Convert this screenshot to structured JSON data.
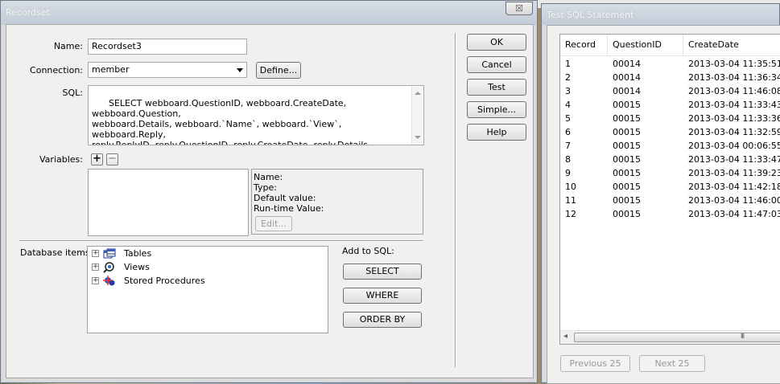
{
  "recordset_dialog": {
    "title": "Recordset",
    "close_label": "☒",
    "name_label": "Name:",
    "name_value": "Recordset3",
    "connection_label": "Connection:",
    "connection_value": "member",
    "define_button": "Define...",
    "sql_label": "SQL:",
    "sql_text": "SELECT webboard.QuestionID, webboard.CreateDate, webboard.Question,\nwebboard.Details, webboard.`Name`, webboard.`View`, webboard.Reply,\nreply.ReplyID, reply.QuestionID, reply.CreateDate, reply.Details, reply.`Name`\nFROM reply Inner Join webboard ON reply.QuestionID = webboard.QuestionID\nORDER BY webboard.QuestionID",
    "variables_label": "Variables:",
    "add_variable": "+",
    "remove_variable": "−",
    "var_detail": {
      "name_label": "Name:",
      "type_label": "Type:",
      "default_label": "Default value:",
      "runtime_label": "Run-time Value:",
      "edit_button": "Edit..."
    },
    "db_items_label": "Database items:",
    "db_items": [
      {
        "label": "Tables",
        "icon": "tables-icon"
      },
      {
        "label": "Views",
        "icon": "views-icon"
      },
      {
        "label": "Stored Procedures",
        "icon": "stored-procedures-icon"
      }
    ],
    "expander_glyph": "+",
    "add_to_sql_label": "Add to SQL:",
    "select_button": "SELECT",
    "where_button": "WHERE",
    "orderby_button": "ORDER BY",
    "ok_button": "OK",
    "cancel_button": "Cancel",
    "test_button": "Test",
    "simple_button": "Simple...",
    "help_button": "Help"
  },
  "test_dialog": {
    "title": "Test SQL Statement",
    "columns": [
      "Record",
      "QuestionID",
      "CreateDate"
    ],
    "rows": [
      [
        "1",
        "00014",
        "2013-03-04 11:35:51"
      ],
      [
        "2",
        "00014",
        "2013-03-04 11:36:34"
      ],
      [
        "3",
        "00014",
        "2013-03-04 11:46:08"
      ],
      [
        "4",
        "00015",
        "2013-03-04 11:33:43"
      ],
      [
        "5",
        "00015",
        "2013-03-04 11:33:36"
      ],
      [
        "6",
        "00015",
        "2013-03-04 11:32:59"
      ],
      [
        "7",
        "00015",
        "2013-03-04 00:06:55"
      ],
      [
        "8",
        "00015",
        "2013-03-04 11:33:47"
      ],
      [
        "9",
        "00015",
        "2013-03-04 11:39:23"
      ],
      [
        "10",
        "00015",
        "2013-03-04 11:42:18"
      ],
      [
        "11",
        "00015",
        "2013-03-04 11:46:00"
      ],
      [
        "12",
        "00015",
        "2013-03-04 11:47:03"
      ]
    ],
    "hscroll_left": "◂",
    "hscroll_grip": "III",
    "previous_button": "Previous 25",
    "next_button": "Next 25"
  }
}
